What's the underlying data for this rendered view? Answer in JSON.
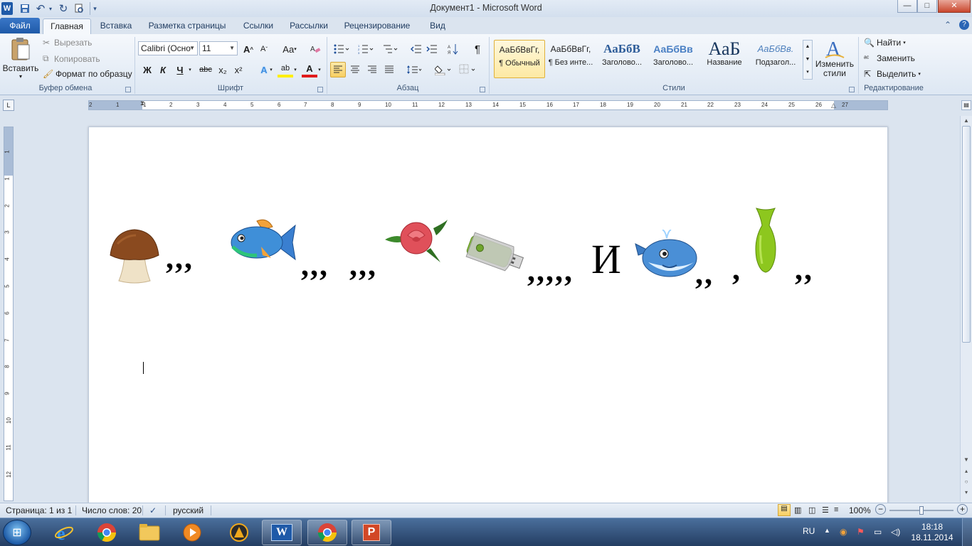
{
  "app": {
    "title": "Документ1 - Microsoft Word",
    "quick_access": {
      "word_icon": "W",
      "undo_arrow": "▾",
      "customize": "▾"
    },
    "window_buttons": {
      "minimize": "—",
      "maximize": "□",
      "close": "✕"
    }
  },
  "ribbon_tabs": {
    "file": "Файл",
    "items": [
      "Главная",
      "Вставка",
      "Разметка страницы",
      "Ссылки",
      "Рассылки",
      "Рецензирование",
      "Вид"
    ],
    "active": "Главная"
  },
  "clipboard": {
    "paste": "Вставить",
    "cut": "Вырезать",
    "copy": "Копировать",
    "format_painter": "Формат по образцу",
    "label": "Буфер обмена"
  },
  "font": {
    "name": "Calibri (Осно",
    "size": "11",
    "grow": "A",
    "shrink": "A",
    "case": "Aa",
    "bold": "Ж",
    "italic": "К",
    "underline": "Ч",
    "strike": "abc",
    "subscript": "x₂",
    "superscript": "x²",
    "effects": "A",
    "highlight": "ab",
    "color": "A",
    "label": "Шрифт"
  },
  "paragraph": {
    "pilcrow": "¶",
    "label": "Абзац"
  },
  "styles": {
    "items": [
      {
        "preview": "АаБбВвГг,",
        "name": "¶ Обычный"
      },
      {
        "preview": "АаБбВвГг,",
        "name": "¶ Без инте..."
      },
      {
        "preview": "АаБбВ",
        "name": "Заголово..."
      },
      {
        "preview": "АаБбВв",
        "name": "Заголово..."
      },
      {
        "preview": "АаБ",
        "name": "Название"
      },
      {
        "preview": "АаБбВв.",
        "name": "Подзагол..."
      }
    ],
    "change": "Изменить стили",
    "label": "Стили"
  },
  "editing": {
    "find": "Найти",
    "replace": "Заменить",
    "select": "Выделить",
    "label": "Редактирование"
  },
  "ruler": {
    "h_labels": [
      "2",
      "1",
      "1",
      "2",
      "3",
      "4",
      "5",
      "6",
      "7",
      "8",
      "9",
      "10",
      "11",
      "12",
      "13",
      "14",
      "15",
      "16",
      "17",
      "18",
      "19",
      "20",
      "21",
      "22",
      "23",
      "24",
      "25",
      "26",
      "27"
    ],
    "v_labels": [
      "1",
      "1",
      "2",
      "3",
      "4",
      "5",
      "6",
      "7",
      "8",
      "9",
      "10",
      "11",
      "12"
    ],
    "corner": "L"
  },
  "document": {
    "commas": {
      "after_mushroom": ",,,",
      "after_fish": ",,,",
      "before_rose": ",,,",
      "after_usb": ",,,,,",
      "letter": "И",
      "after_whale": ",,",
      "before_vase": ",",
      "after_vase": ",,"
    },
    "pictures": [
      "mushroom",
      "fish",
      "rose",
      "usb-flash-drive",
      "whale",
      "green-vase"
    ]
  },
  "status": {
    "page": "Страница: 1 из 1",
    "words": "Число слов: 20",
    "language": "русский",
    "zoom": "100%",
    "zoom_percent": 100,
    "zoom_minus": "−",
    "zoom_plus": "+"
  },
  "taskbar": {
    "word_label": "W",
    "powerpoint_label": "P",
    "language": "RU",
    "time": "18:18",
    "date": "18.11.2014"
  }
}
